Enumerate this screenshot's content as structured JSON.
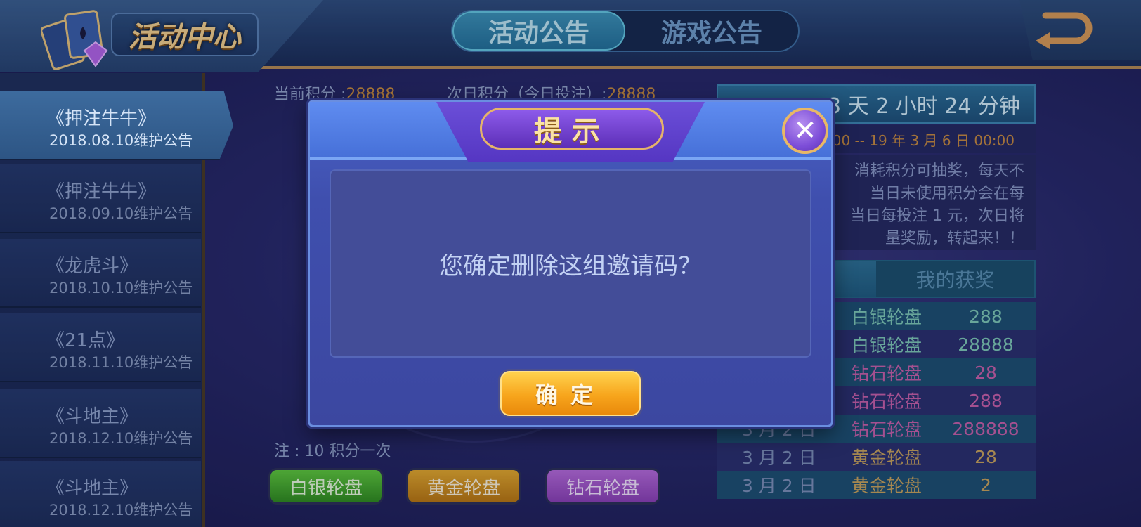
{
  "header": {
    "title": "活动中心",
    "tabs": [
      {
        "label": "活动公告",
        "active": true
      },
      {
        "label": "游戏公告",
        "active": false
      }
    ],
    "back_icon": "back-arrow-icon"
  },
  "sidebar": {
    "items": [
      {
        "title": "《押注牛牛》",
        "date": "2018.08.10维护公告",
        "active": true
      },
      {
        "title": "《押注牛牛》",
        "date": "2018.09.10维护公告",
        "active": false
      },
      {
        "title": "《龙虎斗》",
        "date": "2018.10.10维护公告",
        "active": false
      },
      {
        "title": "《21点》",
        "date": "2018.11.10维护公告",
        "active": false
      },
      {
        "title": "《斗地主》",
        "date": "2018.12.10维护公告",
        "active": false
      },
      {
        "title": "《斗地主》",
        "date": "2018.12.10维护公告",
        "active": false
      }
    ]
  },
  "main": {
    "current_points_label": "当前积分 :",
    "current_points_value": "28888",
    "next_day_points_label": "次日积分（今日投注）:",
    "next_day_points_value": "28888",
    "note": "注 : 10 积分一次",
    "wheel_buttons": [
      "白银轮盘",
      "黄金轮盘",
      "钻石轮盘"
    ]
  },
  "right_panel": {
    "countdown": "3 天 2 小时 24 分钟",
    "range": "00:00 -- 19 年 3 月 6 日 00:00",
    "description_lines": [
      "消耗积分可抽奖，每天不",
      "当日未使用积分会在每",
      "当日每投注 1 元，次日将",
      "量奖励，转起来！！"
    ],
    "tabs": [
      {
        "label": "奖",
        "active": true
      },
      {
        "label": "我的获奖",
        "active": false
      }
    ],
    "rows": [
      {
        "date": "",
        "wheel": "白银轮盘",
        "amount": "288",
        "kind": "silver"
      },
      {
        "date": "",
        "wheel": "白银轮盘",
        "amount": "28888",
        "kind": "silver"
      },
      {
        "date": "",
        "wheel": "钻石轮盘",
        "amount": "28",
        "kind": "diamond"
      },
      {
        "date": "",
        "wheel": "钻石轮盘",
        "amount": "288",
        "kind": "diamond"
      },
      {
        "date": "3 月 2 日",
        "wheel": "钻石轮盘",
        "amount": "288888",
        "kind": "diamond"
      },
      {
        "date": "3 月 2 日",
        "wheel": "黄金轮盘",
        "amount": "28",
        "kind": "gold"
      },
      {
        "date": "3 月 2 日",
        "wheel": "黄金轮盘",
        "amount": "2",
        "kind": "gold"
      }
    ]
  },
  "dialog": {
    "title": "提示",
    "message": "您确定删除这组邀请码？",
    "confirm_label": "确定",
    "close_icon": "close-icon"
  },
  "colors": {
    "points_value": "#c98b3b",
    "silver": "#7ec9b4",
    "diamond": "#c860a8",
    "gold": "#c9a35a",
    "confirm": "#f7a51c"
  }
}
